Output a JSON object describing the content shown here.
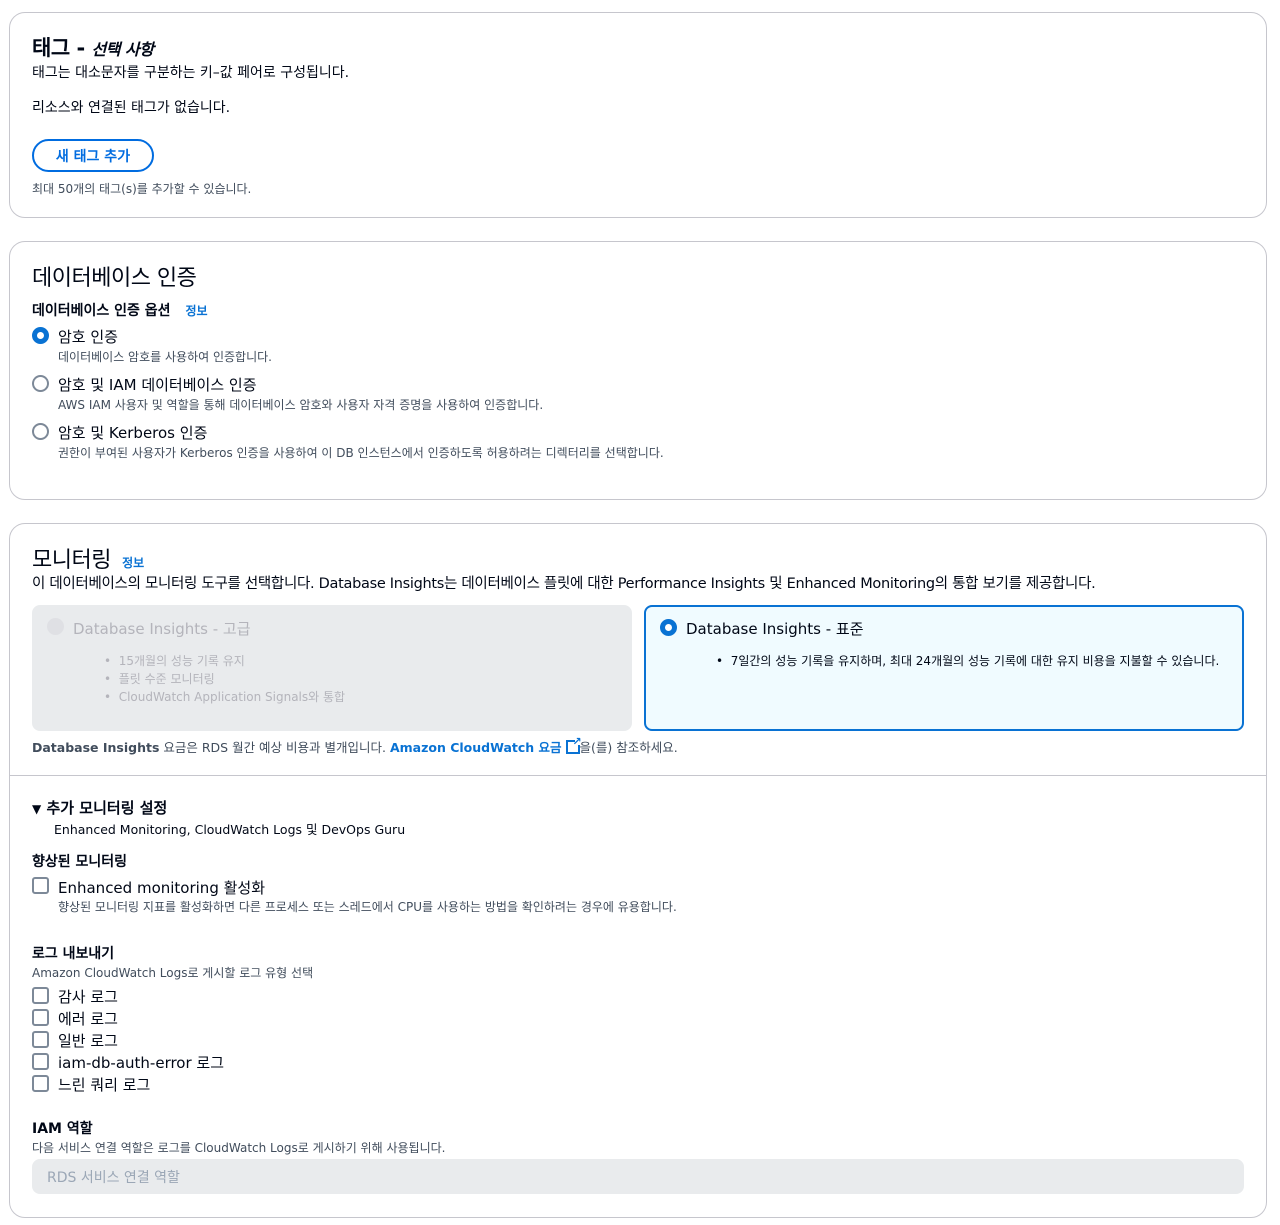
{
  "tags": {
    "title": "태그 -",
    "title_optional": "선택 사항",
    "description": "태그는 대소문자를 구분하는 키–값 페어로 구성됩니다.",
    "empty_text": "리소스와 연결된 태그가 없습니다.",
    "add_button": "새 태그 추가",
    "limit_text": "최대 50개의 태그(s)를 추가할 수 있습니다."
  },
  "db_auth": {
    "title": "데이터베이스 인증",
    "options_label": "데이터베이스 인증 옵션",
    "info_link": "정보",
    "options": [
      {
        "label": "암호 인증",
        "description": "데이터베이스 암호를 사용하여 인증합니다.",
        "selected": true
      },
      {
        "label": "암호 및 IAM 데이터베이스 인증",
        "description": "AWS IAM 사용자 및 역할을 통해 데이터베이스 암호와 사용자 자격 증명을 사용하여 인증합니다.",
        "selected": false
      },
      {
        "label": "암호 및 Kerberos 인증",
        "description": "권한이 부여된 사용자가 Kerberos 인증을 사용하여 이 DB 인스턴스에서 인증하도록 허용하려는 디렉터리를 선택합니다.",
        "selected": false
      }
    ]
  },
  "monitoring": {
    "title": "모니터링",
    "info_link": "정보",
    "description": "이 데이터베이스의 모니터링 도구를 선택합니다. Database Insights는 데이터베이스 플릿에 대한 Performance Insights 및 Enhanced Monitoring의 통합 보기를 제공합니다.",
    "advanced": {
      "label": "Database Insights - 고급",
      "bullets": [
        "15개월의 성능 기록 유지",
        "플릿 수준 모니터링",
        "CloudWatch Application Signals와 통합"
      ],
      "disabled": true
    },
    "standard": {
      "label": "Database Insights - 표준",
      "bullets": [
        "7일간의 성능 기록을 유지하며, 최대 24개월의 성능 기록에 대한 유지 비용을 지불할 수 있습니다."
      ],
      "selected": true
    },
    "pricing_prefix": "Database Insights",
    "pricing_mid": " 요금은 RDS 월간 예상 비용과 별개입니다. ",
    "pricing_link": "Amazon CloudWatch 요금",
    "pricing_suffix": "을(를) 참조하세요.",
    "additional": {
      "title": "추가 모니터링 설정",
      "subtitle": "Enhanced Monitoring, CloudWatch Logs 및 DevOps Guru"
    },
    "enhanced": {
      "label": "향상된 모니터링",
      "checkbox_label": "Enhanced monitoring 활성화",
      "checkbox_desc": "향상된 모니터링 지표를 활성화하면 다른 프로세스 또는 스레드에서 CPU를 사용하는 방법을 확인하려는 경우에 유용합니다."
    },
    "log_export": {
      "label": "로그 내보내기",
      "description": "Amazon CloudWatch Logs로 게시할 로그 유형 선택",
      "logs": [
        "감사 로그",
        "에러 로그",
        "일반 로그",
        "iam-db-auth-error 로그",
        "느린 쿼리 로그"
      ]
    },
    "iam_role": {
      "label": "IAM 역할",
      "description": "다음 서비스 연결 역할은 로그를 CloudWatch Logs로 게시하기 위해 사용됩니다.",
      "value": "RDS 서비스 연결 역할"
    }
  }
}
